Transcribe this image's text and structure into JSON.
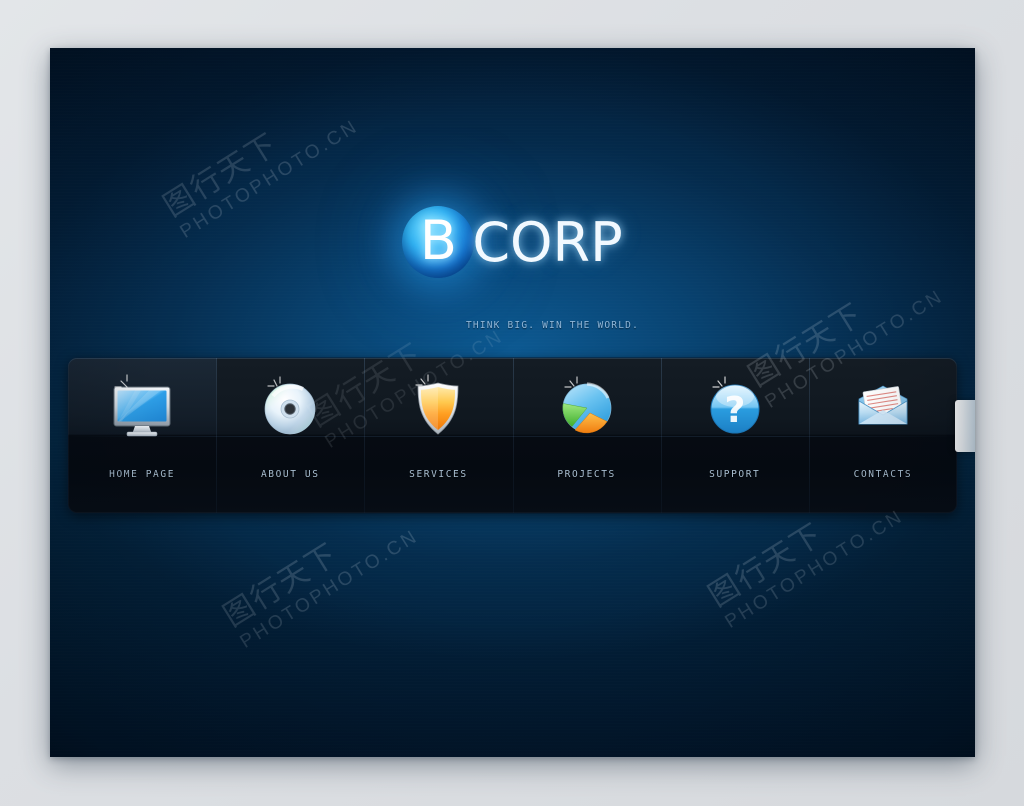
{
  "page": {
    "background_color": "#dcdfe3",
    "panel_color": "#01203c",
    "accent_color": "#2fb4f5"
  },
  "logo": {
    "mark_letter": "B",
    "wordmark": "CORP",
    "tagline": "THINK BIG. WIN THE WORLD.",
    "mark_icon": "blue-glow-circle-icon"
  },
  "nav": {
    "items": [
      {
        "label": "HOME PAGE",
        "icon": "monitor-icon",
        "active": true
      },
      {
        "label": "ABOUT US",
        "icon": "compact-disc-icon",
        "active": false
      },
      {
        "label": "SERVICES",
        "icon": "shield-icon",
        "active": false
      },
      {
        "label": "PROJECTS",
        "icon": "pie-chart-icon",
        "active": false
      },
      {
        "label": "SUPPORT",
        "icon": "question-mark-icon",
        "active": false
      },
      {
        "label": "CONTACTS",
        "icon": "envelope-mail-icon",
        "active": false
      }
    ]
  },
  "side_tab": {
    "name": "side-pull-tab"
  },
  "watermarks": {
    "text": "PHOTOPHOTO.CN",
    "chinese": "图行天下"
  }
}
